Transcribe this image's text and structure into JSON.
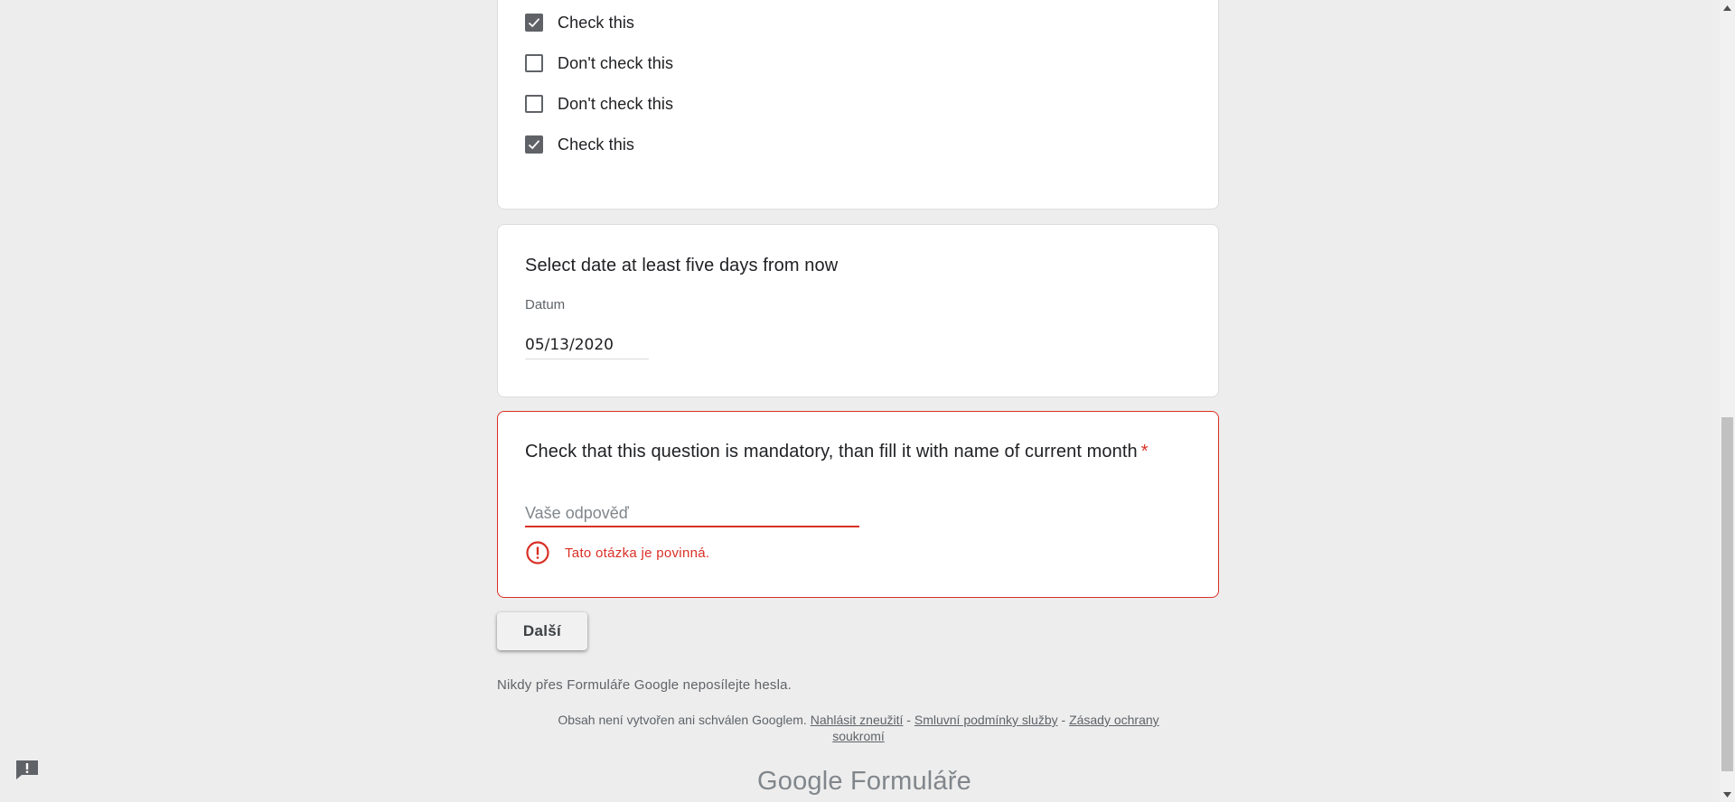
{
  "checkbox_question": {
    "options": [
      {
        "label": "Check this",
        "checked": true
      },
      {
        "label": "Don't check this",
        "checked": false
      },
      {
        "label": "Don't check this",
        "checked": false
      },
      {
        "label": "Check this",
        "checked": true
      }
    ]
  },
  "date_question": {
    "title": "Select date at least five days from now",
    "caption": "Datum",
    "value": "05/13/2020"
  },
  "month_question": {
    "title": "Check that this question is mandatory, than fill it with name of current month",
    "required_marker": "*",
    "placeholder": "Vaše odpověď",
    "value": "",
    "error_message": "Tato otázka je povinná."
  },
  "next_button": {
    "label": "Další"
  },
  "footer": {
    "password_warning": "Nikdy přes Formuláře Google neposílejte hesla.",
    "legal_prefix": "Obsah není vytvořen ani schválen Googlem.",
    "report_link": "Nahlásit zneužití",
    "separator": " - ",
    "terms_link": "Smluvní podmínky služby",
    "privacy_link": "Zásady ochrany soukromí",
    "brand_google": "Google",
    "brand_product": "Formuláře"
  },
  "icons": {
    "checkmark": "check-icon",
    "error": "error-circle-icon",
    "feedback": "feedback-icon"
  },
  "colors": {
    "error": "#d93025",
    "checkbox": "#5f6368",
    "background": "#ededed"
  }
}
